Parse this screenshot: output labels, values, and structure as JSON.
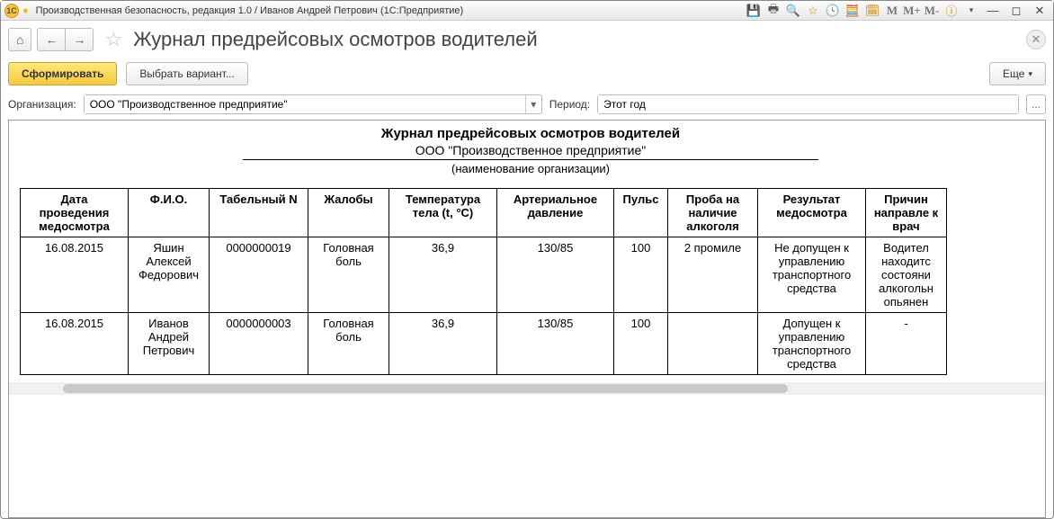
{
  "window": {
    "title": "Производственная безопасность, редакция 1.0 / Иванов Андрей Петрович  (1С:Предприятие)"
  },
  "mem_letters": {
    "m": "M",
    "mp": "M+",
    "mm": "M-"
  },
  "page": {
    "title": "Журнал предрейсовых осмотров водителей"
  },
  "toolbar": {
    "generate": "Сформировать",
    "choose_variant": "Выбрать вариант...",
    "more": "Еще",
    "ellipsis": "..."
  },
  "filters": {
    "org_label": "Организация:",
    "org_value": "ООО \"Производственное предприятие\"",
    "period_label": "Период:",
    "period_value": "Этот год"
  },
  "report": {
    "title": "Журнал предрейсовых осмотров водителей",
    "org": "ООО \"Производственное предприятие\"",
    "sub": "(наименование организации)",
    "headers": {
      "date": "Дата проведения медосмотра",
      "fio": "Ф.И.О.",
      "tabno": "Табельный N",
      "complaints": "Жалобы",
      "temp": "Температура тела (t, °C)",
      "bp": "Артериальное давление",
      "pulse": "Пульс",
      "alcohol": "Проба на наличие алкоголя",
      "result": "Результат медосмотра",
      "reason": "Причин направле к врач"
    },
    "rows": [
      {
        "date": "16.08.2015",
        "fio": "Яшин Алексей Федорович",
        "tabno": "0000000019",
        "complaints": "Головная боль",
        "temp": "36,9",
        "bp": "130/85",
        "pulse": "100",
        "alcohol": "2 промиле",
        "result": "Не допущен к управлению транспортного средства",
        "reason": "Водител находитс состояни алкогольн опьянен"
      },
      {
        "date": "16.08.2015",
        "fio": "Иванов Андрей Петрович",
        "tabno": "0000000003",
        "complaints": "Головная боль",
        "temp": "36,9",
        "bp": "130/85",
        "pulse": "100",
        "alcohol": "",
        "result": "Допущен к управлению транспортного средства",
        "reason": "-"
      }
    ]
  }
}
